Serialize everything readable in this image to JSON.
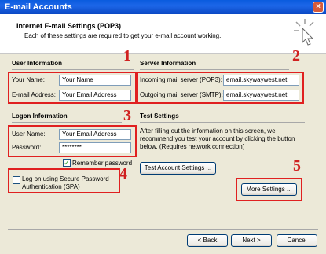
{
  "window": {
    "title": "E-mail Accounts",
    "close_glyph": "×"
  },
  "header": {
    "title": "Internet E-mail Settings (POP3)",
    "subtitle": "Each of these settings are required to get your e-mail account working."
  },
  "user_info": {
    "section": "User Information",
    "name_label": "Your Name:",
    "name_value": "Your Name",
    "email_label": "E-mail Address:",
    "email_value": "Your Email Address"
  },
  "server_info": {
    "section": "Server Information",
    "incoming_label": "Incoming mail server (POP3):",
    "incoming_value": "email.skywaywest.net",
    "outgoing_label": "Outgoing mail server (SMTP):",
    "outgoing_value": "email.skywaywest.net"
  },
  "logon_info": {
    "section": "Logon Information",
    "username_label": "User Name:",
    "username_value": "Your Email Address",
    "password_label": "Password:",
    "password_value": "********",
    "remember_label": "Remember password",
    "remember_checked": true
  },
  "spa": {
    "label_line1": "Log on using Secure Password",
    "label_line2": "Authentication (SPA)",
    "checked": false
  },
  "test_settings": {
    "section": "Test Settings",
    "description": "After filling out the information on this screen, we recommend you test your account by clicking the button below. (Requires network connection)",
    "test_button": "Test Account Settings ...",
    "more_button": "More Settings ..."
  },
  "footer": {
    "back": "< Back",
    "next": "Next >",
    "cancel": "Cancel"
  },
  "annotations": [
    "1",
    "2",
    "3",
    "4",
    "5"
  ],
  "colors": {
    "annotation": "#E02020",
    "titlebar": "#0A5BDE",
    "dialog_bg": "#ECE9D8"
  }
}
